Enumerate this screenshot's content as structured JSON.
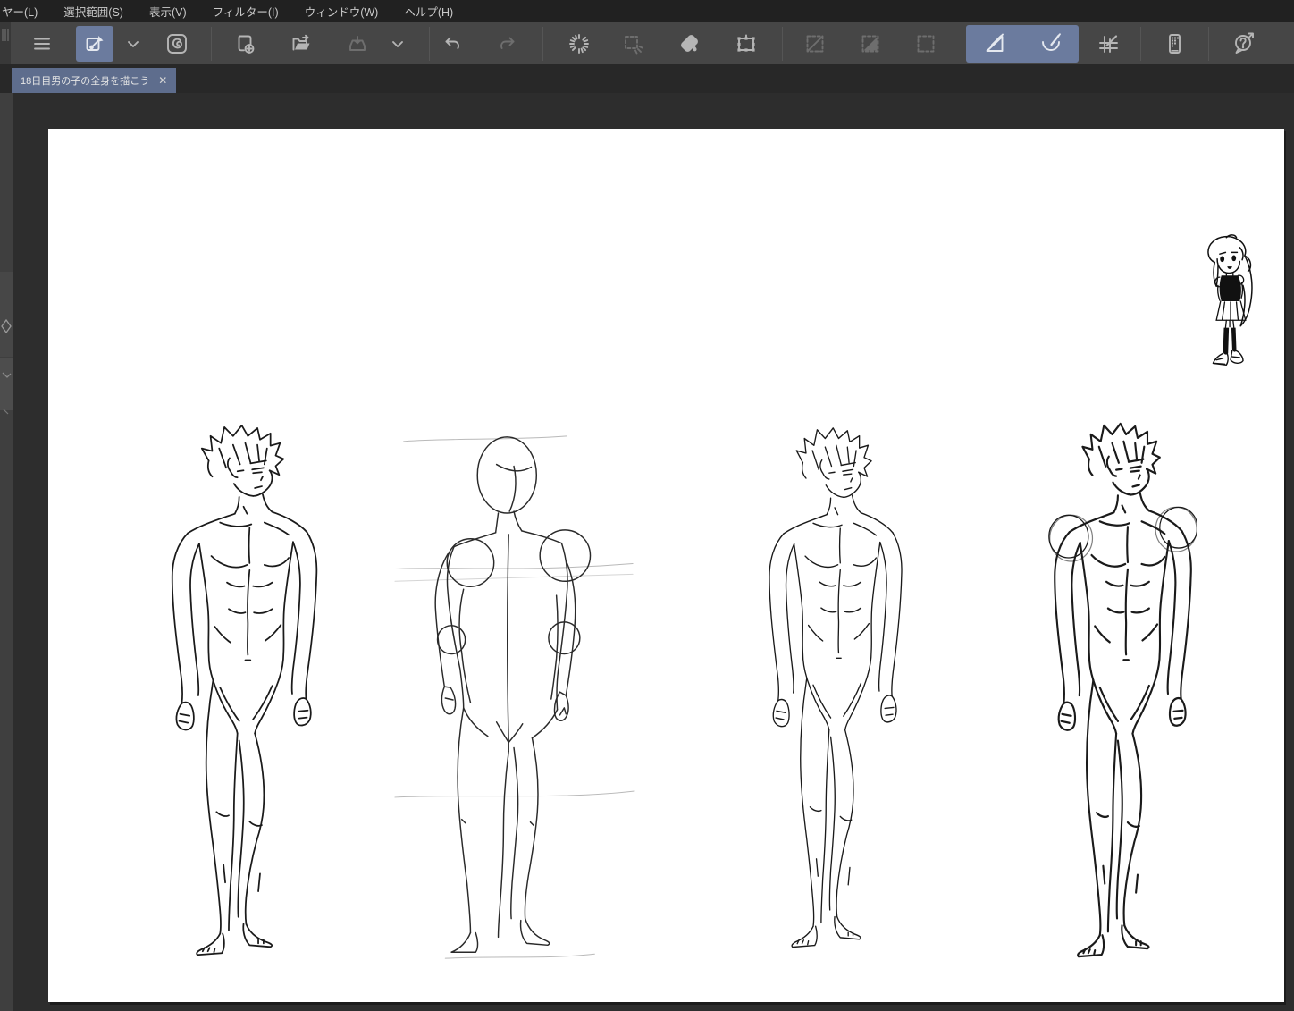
{
  "menubar": {
    "items": [
      "ヤー(L)",
      "選択範囲(S)",
      "表示(V)",
      "フィルター(I)",
      "ウィンドウ(W)",
      "ヘルプ(H)"
    ]
  },
  "toolbar": {
    "buttons": [
      {
        "name": "main-menu",
        "icon": "hamburger-menu-icon",
        "state": "normal"
      },
      {
        "name": "operation-tool",
        "icon": "operation-tool-icon",
        "state": "active"
      },
      {
        "name": "tool-dropdown",
        "icon": "chevron-down-icon",
        "state": "normal"
      },
      {
        "name": "open-clip-studio",
        "icon": "clip-studio-logo-icon",
        "state": "normal"
      },
      {
        "name": "new-document",
        "icon": "new-document-icon",
        "state": "normal"
      },
      {
        "name": "open-file",
        "icon": "open-folder-icon",
        "state": "normal"
      },
      {
        "name": "save",
        "icon": "save-icon",
        "state": "disabled"
      },
      {
        "name": "save-dropdown",
        "icon": "chevron-down-icon",
        "state": "normal"
      },
      {
        "name": "undo",
        "icon": "undo-arrow-icon",
        "state": "normal"
      },
      {
        "name": "redo",
        "icon": "redo-arrow-icon",
        "state": "disabled"
      },
      {
        "name": "clear-selection",
        "icon": "deselect-burst-icon",
        "state": "normal"
      },
      {
        "name": "reselect",
        "icon": "reselect-dashed-icon",
        "state": "disabled"
      },
      {
        "name": "fill",
        "icon": "paint-bucket-icon",
        "state": "normal"
      },
      {
        "name": "scale-rotate",
        "icon": "transform-handles-icon",
        "state": "normal"
      },
      {
        "name": "selection-launcher",
        "icon": "dashed-square-diagonal-icon",
        "state": "disabled"
      },
      {
        "name": "selection-mask",
        "icon": "dashed-square-triangle-icon",
        "state": "disabled"
      },
      {
        "name": "selection-border",
        "icon": "dashed-square-icon",
        "state": "disabled"
      },
      {
        "name": "snap-to-ruler",
        "icon": "snap-ruler-icon",
        "state": "active"
      },
      {
        "name": "snap-to-special-ruler",
        "icon": "snap-special-ruler-icon",
        "state": "active"
      },
      {
        "name": "snap-to-grid",
        "icon": "snap-grid-icon",
        "state": "normal"
      },
      {
        "name": "companion-mode",
        "icon": "smartphone-icon",
        "state": "normal"
      },
      {
        "name": "help",
        "icon": "help-bubble-icon",
        "state": "normal"
      }
    ]
  },
  "tabbar": {
    "tabs": [
      {
        "title": "18日目男の子の全身を描こう",
        "close_icon": "✕",
        "active": true
      }
    ]
  },
  "canvas": {
    "figures": [
      {
        "name": "male-full-body-lineart-1"
      },
      {
        "name": "male-full-body-construction-sketch"
      },
      {
        "name": "male-full-body-lineart-2"
      },
      {
        "name": "male-full-body-lineart-3-shoulder-guides"
      },
      {
        "name": "chibi-girl-reference"
      }
    ]
  },
  "colors": {
    "menubar_bg": "#212121",
    "toolbar_bg": "#464646",
    "active_tool_bg": "#6b7b9e",
    "tab_bg": "#5e6d8d",
    "workspace_bg": "#2d2d2d",
    "dock_strip_bg": "#3f3f3f",
    "canvas_bg": "#ffffff",
    "icon_color": "#b5b5b5",
    "icon_disabled": "#6e6e6e",
    "line_art": "#1a1a1a"
  }
}
